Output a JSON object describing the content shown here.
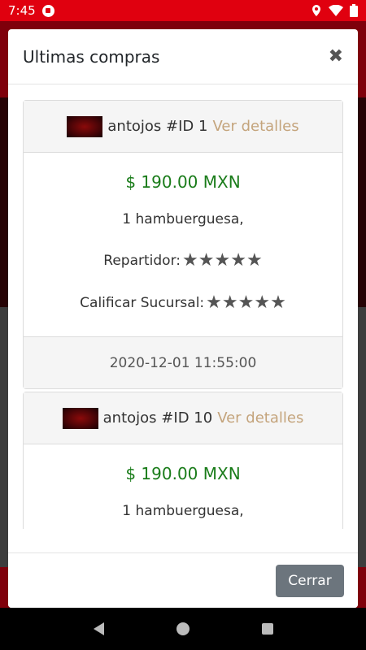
{
  "status_bar": {
    "time": "7:45",
    "icons": [
      "app-notification-icon",
      "location-icon",
      "wifi-icon",
      "battery-icon"
    ]
  },
  "modal": {
    "title": "Ultimas compras",
    "close_symbol": "✖",
    "footer_button": "Cerrar"
  },
  "orders": [
    {
      "store": "antojos",
      "id_label": "#ID 1",
      "details_link": "Ver detalles",
      "price": "$ 190.00 MXN",
      "items": "1 hambuerguesa,",
      "driver_label": "Repartidor:",
      "driver_rating": 5,
      "branch_label": "Calificar Sucursal:",
      "branch_rating": 5,
      "date": "2020-12-01 11:55:00"
    },
    {
      "store": "antojos",
      "id_label": "#ID 10",
      "details_link": "Ver detalles",
      "price": "$ 190.00 MXN",
      "items": "1 hambuerguesa,"
    }
  ],
  "colors": {
    "price": "#1a7c1a",
    "link": "#c4a47c",
    "status_bar": "#e0000f",
    "button": "#6c757d"
  }
}
